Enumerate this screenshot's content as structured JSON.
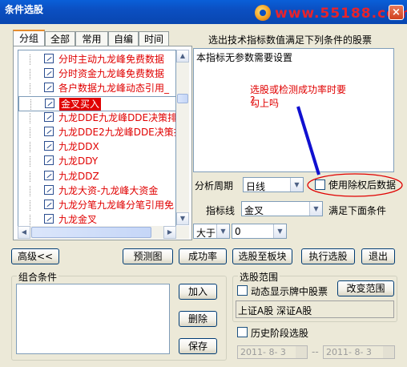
{
  "window": {
    "title": "条件选股",
    "watermark": "www.55188.com",
    "close": "×"
  },
  "tabs": [
    "分组",
    "全部",
    "常用",
    "自编",
    "时间"
  ],
  "tree_items": [
    {
      "label": "分时主动九龙峰免费数据"
    },
    {
      "label": "分时资金九龙峰免费数据"
    },
    {
      "label": "各户数据九龙峰动态引用_"
    },
    {
      "label": "金叉买入",
      "selected": true
    },
    {
      "label": "九龙DDE九龙峰DDE决策排序"
    },
    {
      "label": "九龙DDE2九龙峰DDE决策排序"
    },
    {
      "label": "九龙DDX"
    },
    {
      "label": "九龙DDY"
    },
    {
      "label": "九龙DDZ"
    },
    {
      "label": "九龙大资-九龙峰大资金"
    },
    {
      "label": "九龙分笔九龙峰分笔引用免"
    },
    {
      "label": "九龙金叉"
    }
  ],
  "right": {
    "header": "选出技术指标数值满足下列条件的股票",
    "description": "本指标无参数需要设置",
    "note_line1": "选股或检测成功率时要勾上吗",
    "note_line2": "?"
  },
  "form": {
    "period_label": "分析周期",
    "period_value": "日线",
    "exright_label": "使用除权后数据",
    "indicator_label": "指标线",
    "indicator_value": "金叉",
    "satisfy_label": "满足下面条件",
    "op_value": "大于",
    "threshold_value": "0"
  },
  "buttons": {
    "advanced": "高级<<",
    "forecast": "预测图",
    "success_rate": "成功率",
    "to_block": "选股至板块",
    "execute": "执行选股",
    "exit": "退出",
    "add": "加入",
    "delete": "删除",
    "save": "保存",
    "change_range": "改变范围"
  },
  "combo": {
    "label": "组合条件"
  },
  "range": {
    "label": "选股范围",
    "dynamic_label": "动态显示牌中股票",
    "range_text": "上证A股 深证A股",
    "history_label": "历史阶段选股",
    "date_from": "2011- 8- 3",
    "date_sep": "--",
    "date_to": "2011- 8- 3"
  },
  "colors": {
    "accent_red": "#e00000",
    "annotation_blue": "#1010d0"
  }
}
